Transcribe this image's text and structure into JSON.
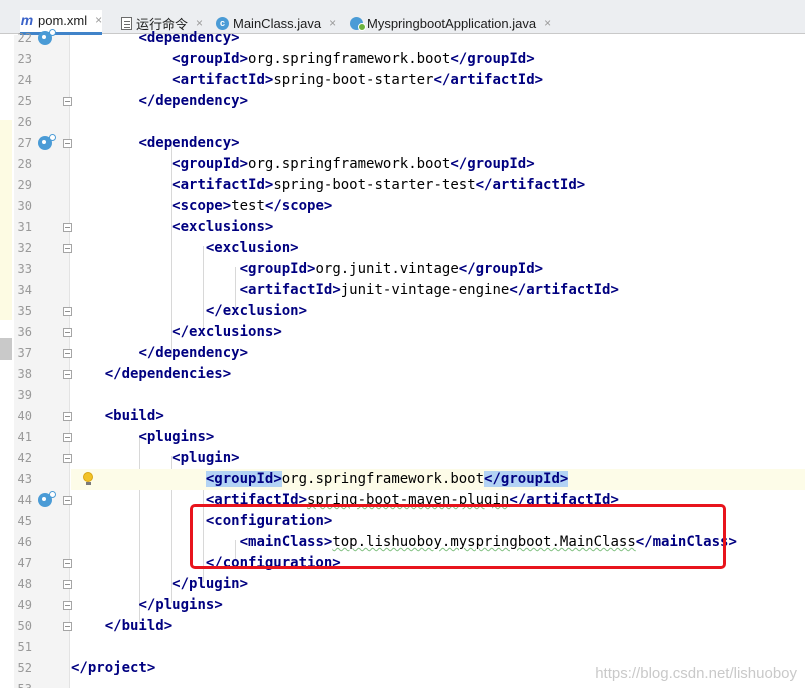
{
  "tabs": [
    {
      "label": "pom.xml",
      "icon": "maven-icon",
      "active": true
    },
    {
      "label": "运行命令",
      "icon": "text-file-icon",
      "active": false
    },
    {
      "label": "MainClass.java",
      "icon": "java-class-icon",
      "active": false
    },
    {
      "label": "MyspringbootApplication.java",
      "icon": "spring-boot-class-icon",
      "active": false
    }
  ],
  "tab_close_glyph": "×",
  "editor": {
    "lines": [
      {
        "n": "22",
        "t": "        <dependency>"
      },
      {
        "n": "23",
        "t": "            <groupId>org.springframework.boot</groupId>"
      },
      {
        "n": "24",
        "t": "            <artifactId>spring-boot-starter</artifactId>"
      },
      {
        "n": "25",
        "t": "        </dependency>"
      },
      {
        "n": "26",
        "t": ""
      },
      {
        "n": "27",
        "t": "        <dependency>"
      },
      {
        "n": "28",
        "t": "            <groupId>org.springframework.boot</groupId>"
      },
      {
        "n": "29",
        "t": "            <artifactId>spring-boot-starter-test</artifactId>"
      },
      {
        "n": "30",
        "t": "            <scope>test</scope>"
      },
      {
        "n": "31",
        "t": "            <exclusions>"
      },
      {
        "n": "32",
        "t": "                <exclusion>"
      },
      {
        "n": "33",
        "t": "                    <groupId>org.junit.vintage</groupId>"
      },
      {
        "n": "34",
        "t": "                    <artifactId>junit-vintage-engine</artifactId>"
      },
      {
        "n": "35",
        "t": "                </exclusion>"
      },
      {
        "n": "36",
        "t": "            </exclusions>"
      },
      {
        "n": "37",
        "t": "        </dependency>"
      },
      {
        "n": "38",
        "t": "    </dependencies>"
      },
      {
        "n": "39",
        "t": ""
      },
      {
        "n": "40",
        "t": "    <build>"
      },
      {
        "n": "41",
        "t": "        <plugins>"
      },
      {
        "n": "42",
        "t": "            <plugin>"
      },
      {
        "n": "43",
        "t": "                <groupId>org.springframework.boot</groupId>"
      },
      {
        "n": "44",
        "t": "                <artifactId>spring-boot-maven-plugin</artifactId>"
      },
      {
        "n": "45",
        "t": "                <configuration>"
      },
      {
        "n": "46",
        "t": "                    <mainClass>top.lishuoboy.myspringboot.MainClass</mainClass>"
      },
      {
        "n": "47",
        "t": "                </configuration>"
      },
      {
        "n": "48",
        "t": "            </plugin>"
      },
      {
        "n": "49",
        "t": "        </plugins>"
      },
      {
        "n": "50",
        "t": "    </build>"
      },
      {
        "n": "51",
        "t": ""
      },
      {
        "n": "52",
        "t": "</project>"
      },
      {
        "n": "53",
        "t": ""
      }
    ],
    "current_line": "43",
    "highlighted_tag_line": "43",
    "annotated_lines": [
      "45",
      "46",
      "47"
    ]
  },
  "watermark": "https://blog.csdn.net/lishuoboy",
  "colors": {
    "tag": "#000080",
    "tag_highlight": "#b3d3f4",
    "current_line": "#fdfce8",
    "annotation_box": "#e8141c",
    "active_tab_underline": "#4083c9"
  }
}
